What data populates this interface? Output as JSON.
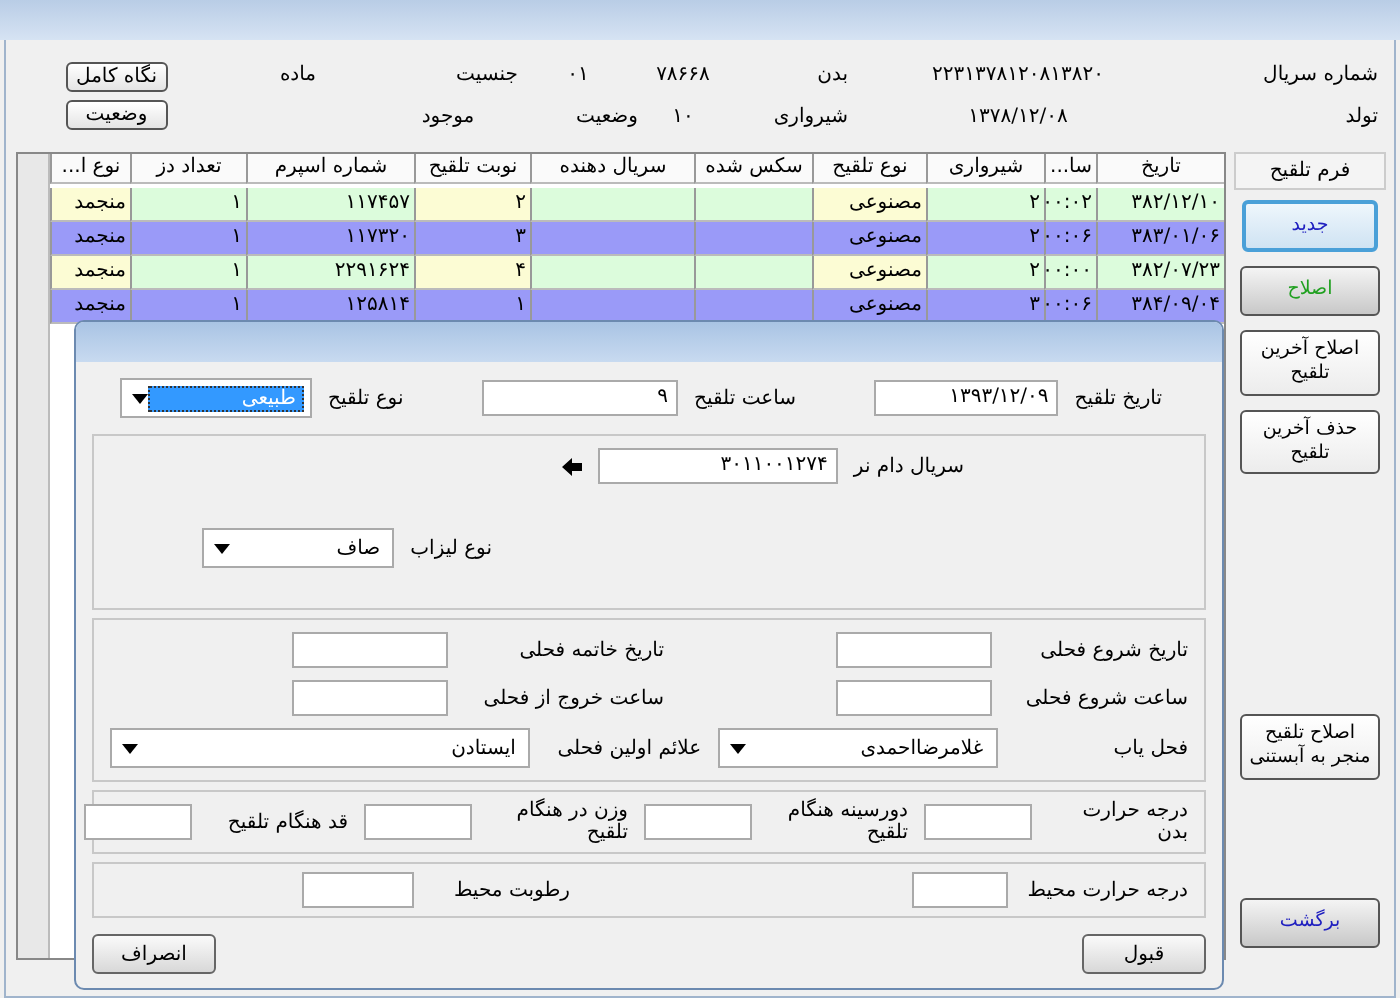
{
  "header": {
    "rows": [
      [
        {
          "kind": "label",
          "text": "شماره سریال"
        },
        {
          "kind": "value",
          "text": "۲۲۳۱۳۷۸۱۲۰۸۱۳۸۲۰"
        },
        {
          "kind": "label",
          "text": "بدن"
        },
        {
          "kind": "value",
          "text": "۷۸۶۶۸"
        },
        {
          "kind": "value",
          "text": "۰۱"
        },
        {
          "kind": "label",
          "text": "جنسیت"
        },
        {
          "kind": "value",
          "text": "ماده"
        }
      ],
      [
        {
          "kind": "label",
          "text": "تولد"
        },
        {
          "kind": "value",
          "text": "۱۳۷۸/۱۲/۰۸"
        },
        {
          "kind": "label",
          "text": "شیرواری"
        },
        {
          "kind": "value",
          "text": "۱۰"
        },
        {
          "kind": "label",
          "text": "وضعیت"
        },
        {
          "kind": "value",
          "text": "موجود"
        }
      ]
    ],
    "buttons": [
      "نگاه کامل",
      "وضعیت"
    ]
  },
  "table": {
    "columns": [
      "تاریخ",
      "سا...",
      "شیرواری",
      "نوع تلقیح",
      "سکس شده",
      "سریال دهنده",
      "نوبت تلقیح",
      "شماره اسپرم",
      "تعداد دز",
      "نوع ا..."
    ],
    "rows": [
      {
        "cells": [
          "۳۸۲/۱۲/۱۰",
          "۰۰:۰۲",
          "۲",
          "مصنوعی",
          null,
          null,
          "۲",
          "۱۱۷۴۵۷",
          "۱",
          "منجمد"
        ]
      },
      {
        "cells": [
          "۳۸۳/۰۱/۰۶",
          "۰۰:۰۶",
          "۲",
          "مصنوعی",
          null,
          null,
          "۳",
          "۱۱۷۳۲۰",
          "۱",
          "منجمد"
        ]
      },
      {
        "cells": [
          "۳۸۲/۰۷/۲۳",
          "۰۰:۰۰",
          "۲",
          "مصنوعی",
          null,
          null,
          "۴",
          "۲۲۹۱۶۲۴",
          "۱",
          "منجمد"
        ]
      },
      {
        "cells": [
          "۳۸۴/۰۹/۰۴",
          "۰۰:۰۶",
          "۳",
          "مصنوعی",
          null,
          null,
          "۱",
          "۱۲۵۸۱۴",
          "۱",
          "منجمد"
        ]
      }
    ]
  },
  "side_panel": {
    "title": "فرم تلقیح",
    "button_groups": [
      [
        {
          "label": "جدید",
          "color": "#2020c0",
          "kind": "focused"
        },
        {
          "label": "اصلاح",
          "color": "#20a020",
          "kind": "gray"
        },
        {
          "label": "اصلاح آخرین تلقیح",
          "color": "#000000",
          "kind": "plain"
        },
        {
          "label": "حذف آخرین تلقیح",
          "color": "#000000",
          "kind": "plain"
        }
      ],
      [
        {
          "label": "اصلاح تلقیح منجر به آبستنی",
          "color": "#000000",
          "kind": "plain"
        }
      ],
      [
        {
          "label": "برگشت",
          "color": "#2020c0",
          "kind": "gray"
        }
      ]
    ]
  },
  "dialog": {
    "date_label": "تاریخ تلقیح",
    "date_value": "۱۳۹۳/۱۲/۰۹",
    "time_label": "ساعت تلقیح",
    "time_value": "۹",
    "type_label": "نوع  تلقیح",
    "type_value": "طبیعی",
    "bull_label": "سریال دام نر",
    "bull_value": "۳۰۱۱۰۰۱۲۷۴",
    "semen_label": "نوع لیزاب",
    "semen_value": "صاف",
    "heat_start_date": "تاریخ شروع فحلی",
    "heat_end_date": "تاریخ خاتمه فحلی",
    "heat_start_time": "ساعت شروع فحلی",
    "heat_exit_time": "ساعت خروج از فحلی",
    "detector_label": "فحل یاب",
    "detector_value": "غلامرضااحمدی",
    "signs_label": "علائم اولین فحلی",
    "signs_value": "ایستادن",
    "measures": [
      "درجه حرارت بدن",
      "دورسینه هنگام تلقیح",
      "وزن در هنگام تلقیح",
      "قد هنگام تلقیح"
    ],
    "env": [
      "درجه حرارت محیط",
      "رطوبت محیط"
    ],
    "ok": "قبول",
    "cancel": "انصراف"
  }
}
